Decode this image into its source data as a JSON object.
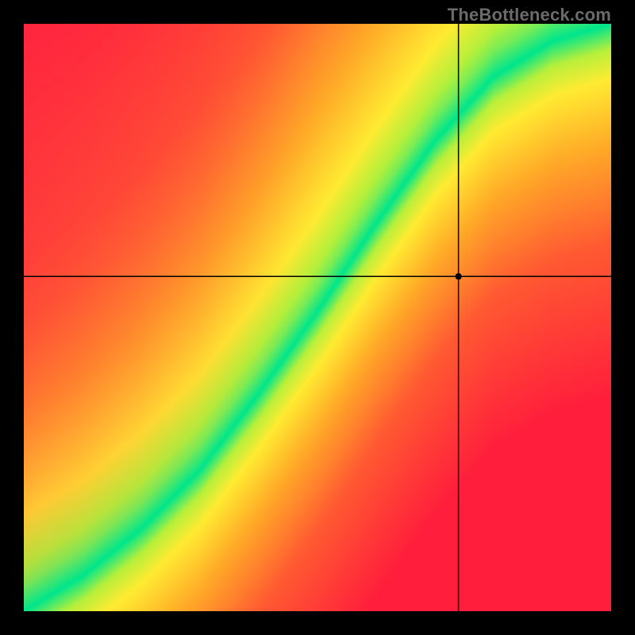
{
  "watermark": "TheBottleneck.com",
  "colors": {
    "black": "#000000",
    "crosshair": "#000000",
    "marker": "#000000"
  },
  "chart_data": {
    "type": "heatmap",
    "title": "",
    "xlabel": "",
    "ylabel": "",
    "xlim": [
      0,
      1
    ],
    "ylim": [
      0,
      1
    ],
    "crosshair": {
      "x": 0.74,
      "y": 0.57
    },
    "marker": {
      "x": 0.74,
      "y": 0.57,
      "r": 4
    },
    "optimal_curve": [
      {
        "x": 0.0,
        "y": 0.0
      },
      {
        "x": 0.1,
        "y": 0.06
      },
      {
        "x": 0.2,
        "y": 0.14
      },
      {
        "x": 0.3,
        "y": 0.24
      },
      {
        "x": 0.4,
        "y": 0.37
      },
      {
        "x": 0.5,
        "y": 0.51
      },
      {
        "x": 0.6,
        "y": 0.66
      },
      {
        "x": 0.7,
        "y": 0.8
      },
      {
        "x": 0.8,
        "y": 0.91
      },
      {
        "x": 0.9,
        "y": 0.97
      },
      {
        "x": 1.0,
        "y": 1.0
      }
    ],
    "band_half_width": 0.045,
    "transition_width": 0.06,
    "colormap_note": "red→orange→yellow→green rainbow, green on optimal ridge",
    "legend": null
  }
}
